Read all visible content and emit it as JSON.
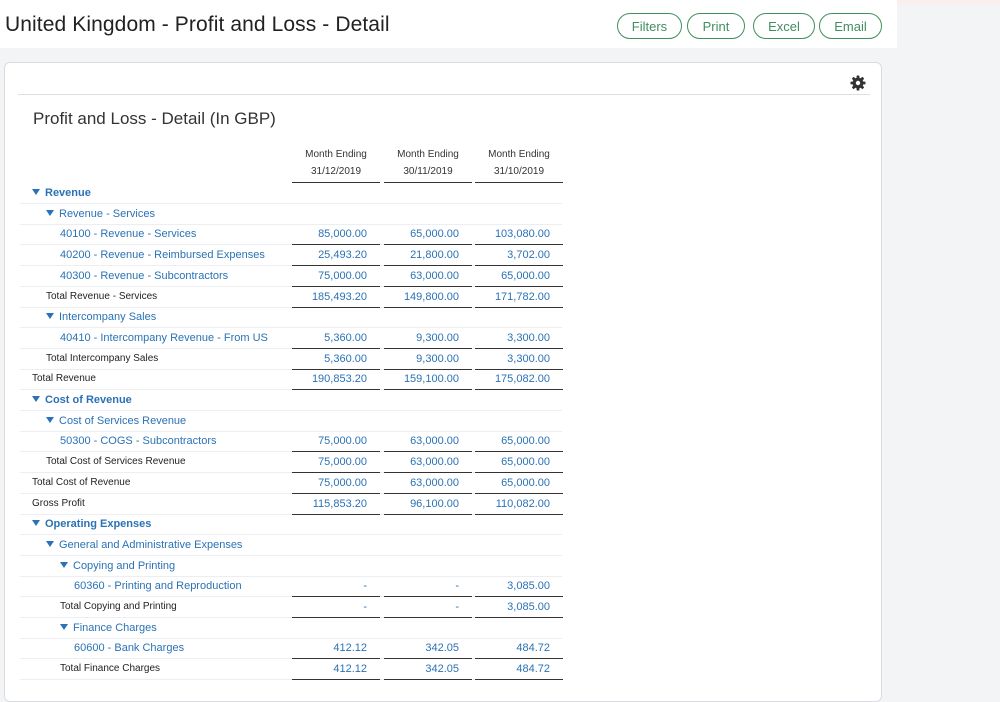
{
  "header": {
    "title": "United Kingdom - Profit and Loss - Detail",
    "buttons": {
      "filters": "Filters",
      "print": "Print",
      "excel": "Excel",
      "email": "Email"
    }
  },
  "report": {
    "title": "Profit and Loss - Detail (In GBP)",
    "columns": [
      {
        "line1": "Month Ending",
        "line2": "31/12/2019"
      },
      {
        "line1": "Month Ending",
        "line2": "30/11/2019"
      },
      {
        "line1": "Month Ending",
        "line2": "31/10/2019"
      }
    ],
    "rows": [
      {
        "label": "Revenue",
        "type": "section",
        "level": 0,
        "values": [
          "",
          "",
          ""
        ]
      },
      {
        "label": "Revenue - Services",
        "type": "group",
        "level": 1,
        "values": [
          "",
          "",
          ""
        ]
      },
      {
        "label": "40100 - Revenue - Services",
        "type": "account",
        "level": 2,
        "values": [
          "85,000.00",
          "65,000.00",
          "103,080.00"
        ]
      },
      {
        "label": "40200 - Revenue - Reimbursed Expenses",
        "type": "account",
        "level": 2,
        "values": [
          "25,493.20",
          "21,800.00",
          "3,702.00"
        ]
      },
      {
        "label": "40300 - Revenue - Subcontractors",
        "type": "account",
        "level": 2,
        "values": [
          "75,000.00",
          "63,000.00",
          "65,000.00"
        ]
      },
      {
        "label": "Total Revenue - Services",
        "type": "total",
        "level": 1,
        "values": [
          "185,493.20",
          "149,800.00",
          "171,782.00"
        ]
      },
      {
        "label": "Intercompany Sales",
        "type": "group",
        "level": 1,
        "values": [
          "",
          "",
          ""
        ]
      },
      {
        "label": "40410 - Intercompany Revenue - From US",
        "type": "account",
        "level": 2,
        "values": [
          "5,360.00",
          "9,300.00",
          "3,300.00"
        ]
      },
      {
        "label": "Total Intercompany Sales",
        "type": "total",
        "level": 1,
        "values": [
          "5,360.00",
          "9,300.00",
          "3,300.00"
        ]
      },
      {
        "label": "Total Revenue",
        "type": "total",
        "level": 0,
        "values": [
          "190,853.20",
          "159,100.00",
          "175,082.00"
        ]
      },
      {
        "label": "Cost of Revenue",
        "type": "section",
        "level": 0,
        "values": [
          "",
          "",
          ""
        ]
      },
      {
        "label": "Cost of Services Revenue",
        "type": "group",
        "level": 1,
        "values": [
          "",
          "",
          ""
        ]
      },
      {
        "label": "50300 - COGS - Subcontractors",
        "type": "account",
        "level": 2,
        "values": [
          "75,000.00",
          "63,000.00",
          "65,000.00"
        ]
      },
      {
        "label": "Total Cost of Services Revenue",
        "type": "total",
        "level": 1,
        "values": [
          "75,000.00",
          "63,000.00",
          "65,000.00"
        ]
      },
      {
        "label": "Total Cost of Revenue",
        "type": "total",
        "level": 0,
        "values": [
          "75,000.00",
          "63,000.00",
          "65,000.00"
        ]
      },
      {
        "label": "Gross Profit",
        "type": "total",
        "level": 0,
        "values": [
          "115,853.20",
          "96,100.00",
          "110,082.00"
        ]
      },
      {
        "label": "Operating Expenses",
        "type": "section",
        "level": 0,
        "values": [
          "",
          "",
          ""
        ]
      },
      {
        "label": "General and Administrative Expenses",
        "type": "group",
        "level": 1,
        "values": [
          "",
          "",
          ""
        ]
      },
      {
        "label": "Copying and Printing",
        "type": "group",
        "level": 2,
        "values": [
          "",
          "",
          ""
        ]
      },
      {
        "label": "60360 - Printing and Reproduction",
        "type": "account",
        "level": 3,
        "values": [
          "-",
          "-",
          "3,085.00"
        ]
      },
      {
        "label": "Total Copying and Printing",
        "type": "total",
        "level": 2,
        "values": [
          "-",
          "-",
          "3,085.00"
        ]
      },
      {
        "label": "Finance Charges",
        "type": "group",
        "level": 2,
        "values": [
          "",
          "",
          ""
        ]
      },
      {
        "label": "60600 - Bank Charges",
        "type": "account",
        "level": 3,
        "values": [
          "412.12",
          "342.05",
          "484.72"
        ]
      },
      {
        "label": "Total Finance Charges",
        "type": "total",
        "level": 2,
        "values": [
          "412.12",
          "342.05",
          "484.72"
        ]
      }
    ]
  },
  "icons": {
    "settings": "gear-icon",
    "expand": "triangle-down-icon"
  },
  "colors": {
    "accent": "#3f8f5f",
    "link": "#2a72b5"
  }
}
